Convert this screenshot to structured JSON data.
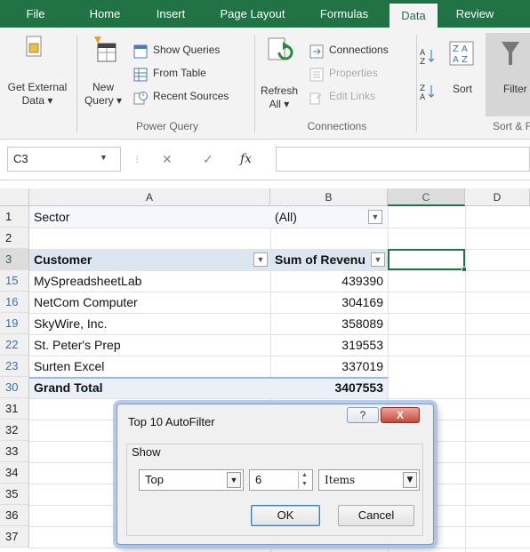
{
  "tabs": [
    {
      "label": "File",
      "active": false
    },
    {
      "label": "Home",
      "active": false
    },
    {
      "label": "Insert",
      "active": false
    },
    {
      "label": "Page Layout",
      "active": false
    },
    {
      "label": "Formulas",
      "active": false
    },
    {
      "label": "Data",
      "active": true
    },
    {
      "label": "Review",
      "active": false
    }
  ],
  "ribbon": {
    "get_external_line1": "Get External",
    "get_external_line2": "Data ▾",
    "new_query_line1": "New",
    "new_query_line2": "Query ▾",
    "show_queries": "Show Queries",
    "from_table": "From Table",
    "recent_sources": "Recent Sources",
    "group_power_query": "Power Query",
    "refresh_line1": "Refresh",
    "refresh_line2": "All ▾",
    "connections": "Connections",
    "properties": "Properties",
    "edit_links": "Edit Links",
    "group_connections": "Connections",
    "sort": "Sort",
    "filter": "Filter",
    "group_sort_filter": "Sort & F"
  },
  "formula_bar": {
    "name_box": "C3",
    "fx": "fx",
    "formula": ""
  },
  "columns": [
    "A",
    "B",
    "C",
    "D"
  ],
  "rows": [
    {
      "num": "1",
      "a": "Sector",
      "b": "(All)"
    },
    {
      "num": "2",
      "a": "",
      "b": ""
    },
    {
      "num": "3",
      "a": "Customer",
      "b": "Sum of Revenu"
    },
    {
      "num": "15",
      "a": "MySpreadsheetLab",
      "b": "439390"
    },
    {
      "num": "16",
      "a": "NetCom Computer",
      "b": "304169"
    },
    {
      "num": "19",
      "a": "SkyWire, Inc.",
      "b": "358089"
    },
    {
      "num": "22",
      "a": "St. Peter's Prep",
      "b": "319553"
    },
    {
      "num": "23",
      "a": "Surten Excel",
      "b": "337019"
    },
    {
      "num": "30",
      "a": "Grand Total",
      "b": "3407553"
    },
    {
      "num": "31",
      "a": "",
      "b": ""
    },
    {
      "num": "32",
      "a": "",
      "b": ""
    },
    {
      "num": "33",
      "a": "",
      "b": ""
    },
    {
      "num": "34",
      "a": "",
      "b": ""
    },
    {
      "num": "35",
      "a": "",
      "b": ""
    },
    {
      "num": "36",
      "a": "",
      "b": ""
    },
    {
      "num": "37",
      "a": "",
      "b": ""
    }
  ],
  "dialog": {
    "title": "Top 10 AutoFilter",
    "help": "?",
    "close": "X",
    "group_label": "Show",
    "direction": "Top",
    "count": "6",
    "unit": "Items",
    "ok": "OK",
    "cancel": "Cancel"
  },
  "colors": {
    "excel_green": "#217346",
    "pivot_header": "#dce6f1",
    "row_number_blue": "#2e75b6"
  }
}
